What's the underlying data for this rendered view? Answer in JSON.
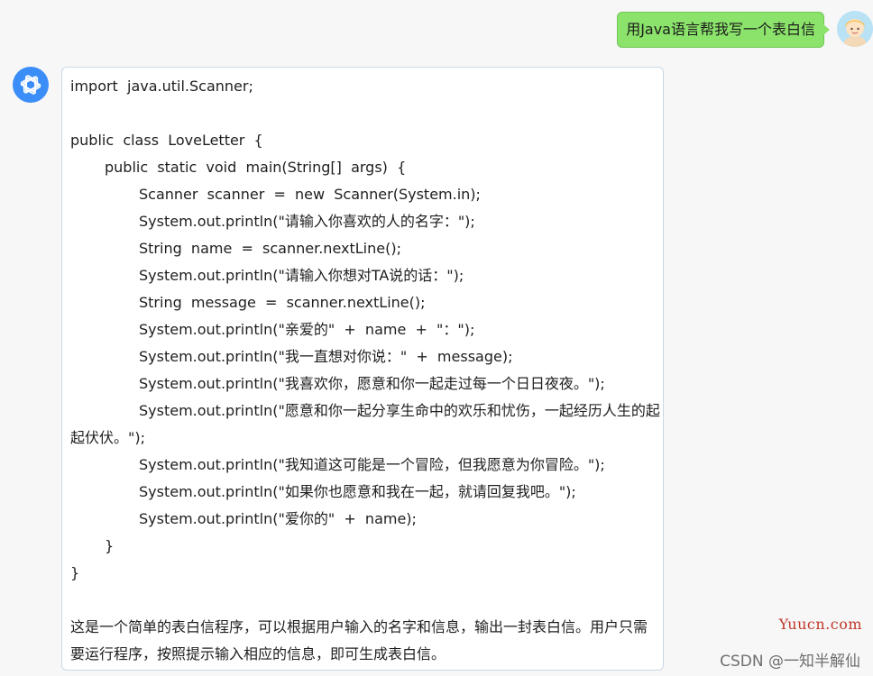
{
  "user_message": {
    "text": "用Java语言帮我写一个表白信",
    "avatar": "user-avatar-icon",
    "bubble_color": "#8be36b"
  },
  "bot_message": {
    "avatar": "openai-logo-icon",
    "avatar_color": "#3b8ef7",
    "code_lines": [
      "import  java.util.Scanner;",
      "",
      "public  class  LoveLetter  {",
      "public  static  void  main(String[]  args)  {",
      "Scanner  scanner  =  new  Scanner(System.in);",
      "System.out.println(\"请输入你喜欢的人的名字：\");",
      "String  name  =  scanner.nextLine();",
      "System.out.println(\"请输入你想对TA说的话：\");",
      "String  message  =  scanner.nextLine();",
      "System.out.println(\"亲爱的\"  +  name  +  \"：\");",
      "System.out.println(\"我一直想对你说：\"  +  message);",
      "System.out.println(\"我喜欢你，愿意和你一起走过每一个日日夜夜。\");",
      "System.out.println(\"愿意和你一起分享生命中的欢乐和忧伤，一起经历人生的起",
      "起伏伏。\");",
      "System.out.println(\"我知道这可能是一个冒险，但我愿意为你冒险。\");",
      "System.out.println(\"如果你也愿意和我在一起，就请回复我吧。\");",
      "System.out.println(\"爱你的\"  +  name);",
      "}",
      "}",
      ""
    ],
    "summary": "这是一个简单的表白信程序，可以根据用户输入的名字和信息，输出一封表白信。用户只需要运行程序，按照提示输入相应的信息，即可生成表白信。"
  },
  "watermarks": {
    "yuucn": "Yuucn.com",
    "csdn": "CSDN @一知半解仙"
  }
}
